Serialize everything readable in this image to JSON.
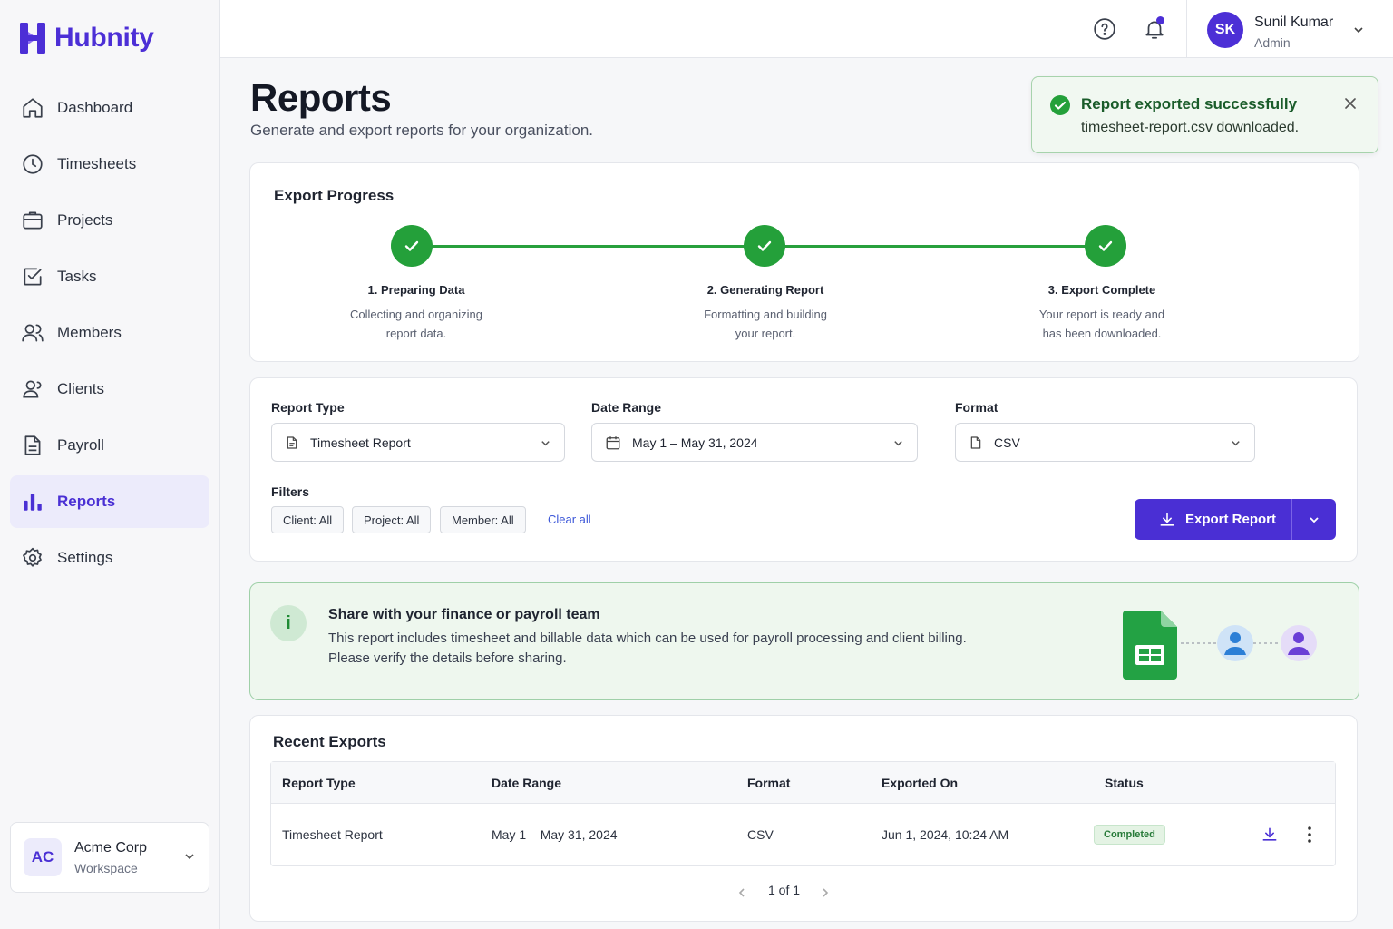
{
  "brand": {
    "name": "Hubnity",
    "accent": "#4c2fd6"
  },
  "sidebar": {
    "items": [
      {
        "label": "Dashboard",
        "icon": "home-icon"
      },
      {
        "label": "Timesheets",
        "icon": "clock-icon"
      },
      {
        "label": "Projects",
        "icon": "briefcase-icon"
      },
      {
        "label": "Tasks",
        "icon": "checkbox-icon"
      },
      {
        "label": "Members",
        "icon": "users-icon"
      },
      {
        "label": "Clients",
        "icon": "user-group-icon"
      },
      {
        "label": "Payroll",
        "icon": "document-icon"
      },
      {
        "label": "Reports",
        "icon": "bar-chart-icon",
        "active": true
      },
      {
        "label": "Settings",
        "icon": "gear-icon"
      }
    ],
    "workspace": {
      "initials": "AC",
      "name": "Acme Corp",
      "type": "Workspace"
    }
  },
  "topbar": {
    "user": {
      "initials": "SK",
      "name": "Sunil Kumar",
      "role": "Admin"
    },
    "icons": [
      "help-icon",
      "bell-icon"
    ]
  },
  "header": {
    "title": "Reports",
    "subtitle": "Generate and export reports for your organization."
  },
  "toast": {
    "title": "Report exported successfully",
    "message": "timesheet-report.csv downloaded."
  },
  "progress": {
    "title": "Export Progress",
    "steps": [
      {
        "label": "1. Preparing Data",
        "desc_line1": "Collecting and organizing",
        "desc_line2": "report data."
      },
      {
        "label": "2. Generating Report",
        "desc_line1": "Formatting and building",
        "desc_line2": "your report."
      },
      {
        "label": "3. Export Complete",
        "desc_line1": "Your report is ready and",
        "desc_line2": "has been downloaded."
      }
    ]
  },
  "form": {
    "report_type": {
      "label": "Report Type",
      "value": "Timesheet Report"
    },
    "date_range": {
      "label": "Date Range",
      "value": "May 1 – May 31, 2024"
    },
    "format": {
      "label": "Format",
      "value": "CSV"
    },
    "filters": {
      "label": "Filters",
      "chips": [
        "Client: All",
        "Project: All",
        "Member: All"
      ],
      "clear_label": "Clear all"
    },
    "export_label": "Export Report"
  },
  "info": {
    "icon_text": "i",
    "title": "Share with your finance or payroll team",
    "line1": "This report includes timesheet and billable data which can be used for payroll processing and client billing.",
    "line2": "Please verify the details before sharing."
  },
  "recent": {
    "title": "Recent Exports",
    "columns": [
      "Report Type",
      "Date Range",
      "Format",
      "Exported On",
      "Status"
    ],
    "rows": [
      {
        "report_type": "Timesheet Report",
        "date_range": "May 1 – May 31, 2024",
        "format": "CSV",
        "exported_on": "Jun 1, 2024, 10:24 AM",
        "status": "Completed"
      }
    ],
    "pagination": "1 of 1"
  }
}
